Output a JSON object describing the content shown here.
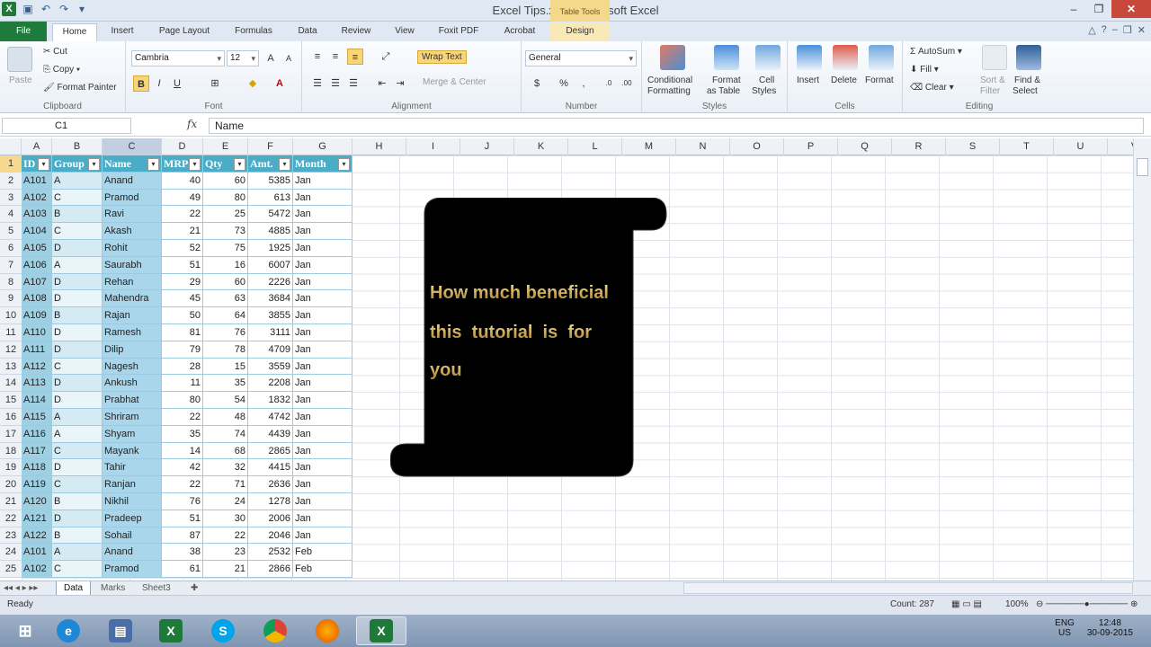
{
  "window": {
    "title": "Excel Tips.xlsx - Microsoft Excel",
    "context_tab": "Table Tools"
  },
  "tabs": [
    "File",
    "Home",
    "Insert",
    "Page Layout",
    "Formulas",
    "Data",
    "Review",
    "View",
    "Foxit PDF",
    "Acrobat",
    "Design"
  ],
  "ribbon": {
    "clipboard": {
      "paste": "Paste",
      "cut": "Cut",
      "copy": "Copy",
      "format_painter": "Format Painter",
      "label": "Clipboard"
    },
    "font": {
      "name": "Cambria",
      "size": "12",
      "label": "Font"
    },
    "alignment": {
      "wrap_text": "Wrap Text",
      "merge_center": "Merge & Center",
      "label": "Alignment"
    },
    "number": {
      "format": "General",
      "label": "Number"
    },
    "styles": {
      "conditional": "Conditional",
      "conditional2": "Formatting",
      "format_table": "Format",
      "format_table2": "as Table",
      "cell_styles": "Cell",
      "cell_styles2": "Styles",
      "label": "Styles"
    },
    "cells": {
      "insert": "Insert",
      "delete": "Delete",
      "format": "Format",
      "label": "Cells"
    },
    "editing": {
      "autosum": "AutoSum",
      "fill": "Fill",
      "clear": "Clear",
      "sort": "Sort &",
      "sort2": "Filter",
      "find": "Find &",
      "find2": "Select",
      "label": "Editing"
    }
  },
  "formula_bar": {
    "name_box": "C1",
    "fx": "fx",
    "content": "Name"
  },
  "columns": [
    "A",
    "B",
    "C",
    "D",
    "E",
    "F",
    "G",
    "H",
    "I",
    "J",
    "K",
    "L",
    "M",
    "N",
    "O",
    "P",
    "Q",
    "R",
    "S",
    "T",
    "U",
    "V"
  ],
  "table": {
    "headers": [
      "ID",
      "Group",
      "Name",
      "MRP",
      "Qty",
      "Amt.",
      "Month"
    ],
    "rows": [
      [
        "A101",
        "A",
        "Anand",
        "40",
        "60",
        "5385",
        "Jan"
      ],
      [
        "A102",
        "C",
        "Pramod",
        "49",
        "80",
        "613",
        "Jan"
      ],
      [
        "A103",
        "B",
        "Ravi",
        "22",
        "25",
        "5472",
        "Jan"
      ],
      [
        "A104",
        "C",
        "Akash",
        "21",
        "73",
        "4885",
        "Jan"
      ],
      [
        "A105",
        "D",
        "Rohit",
        "52",
        "75",
        "1925",
        "Jan"
      ],
      [
        "A106",
        "A",
        "Saurabh",
        "51",
        "16",
        "6007",
        "Jan"
      ],
      [
        "A107",
        "D",
        "Rehan",
        "29",
        "60",
        "2226",
        "Jan"
      ],
      [
        "A108",
        "D",
        "Mahendra",
        "45",
        "63",
        "3684",
        "Jan"
      ],
      [
        "A109",
        "B",
        "Rajan",
        "50",
        "64",
        "3855",
        "Jan"
      ],
      [
        "A110",
        "D",
        "Ramesh",
        "81",
        "76",
        "3111",
        "Jan"
      ],
      [
        "A111",
        "D",
        "Dilip",
        "79",
        "78",
        "4709",
        "Jan"
      ],
      [
        "A112",
        "C",
        "Nagesh",
        "28",
        "15",
        "3559",
        "Jan"
      ],
      [
        "A113",
        "D",
        "Ankush",
        "11",
        "35",
        "2208",
        "Jan"
      ],
      [
        "A114",
        "D",
        "Prabhat",
        "80",
        "54",
        "1832",
        "Jan"
      ],
      [
        "A115",
        "A",
        "Shriram",
        "22",
        "48",
        "4742",
        "Jan"
      ],
      [
        "A116",
        "A",
        "Shyam",
        "35",
        "74",
        "4439",
        "Jan"
      ],
      [
        "A117",
        "C",
        "Mayank",
        "14",
        "68",
        "2865",
        "Jan"
      ],
      [
        "A118",
        "D",
        "Tahir",
        "42",
        "32",
        "4415",
        "Jan"
      ],
      [
        "A119",
        "C",
        "Ranjan",
        "22",
        "71",
        "2636",
        "Jan"
      ],
      [
        "A120",
        "B",
        "Nikhil",
        "76",
        "24",
        "1278",
        "Jan"
      ],
      [
        "A121",
        "D",
        "Pradeep",
        "51",
        "30",
        "2006",
        "Jan"
      ],
      [
        "A122",
        "B",
        "Sohail",
        "87",
        "22",
        "2046",
        "Jan"
      ],
      [
        "A101",
        "A",
        "Anand",
        "38",
        "23",
        "2532",
        "Feb"
      ],
      [
        "A102",
        "C",
        "Pramod",
        "61",
        "21",
        "2866",
        "Feb"
      ]
    ]
  },
  "scroll_note": {
    "line1": "How much beneficial",
    "line2": "this  tutorial  is  for",
    "line3": "you"
  },
  "sheets": [
    "Data",
    "Marks",
    "Sheet3"
  ],
  "status": {
    "ready": "Ready",
    "count": "Count: 287",
    "zoom": "100%"
  },
  "tray": {
    "lang": "ENG",
    "region": "US",
    "time": "12:48",
    "date": "30-09-2015"
  },
  "colors": {
    "table_header": "#4aacc6",
    "band": "#d4ebf3",
    "file_tab": "#1e7b3b"
  }
}
